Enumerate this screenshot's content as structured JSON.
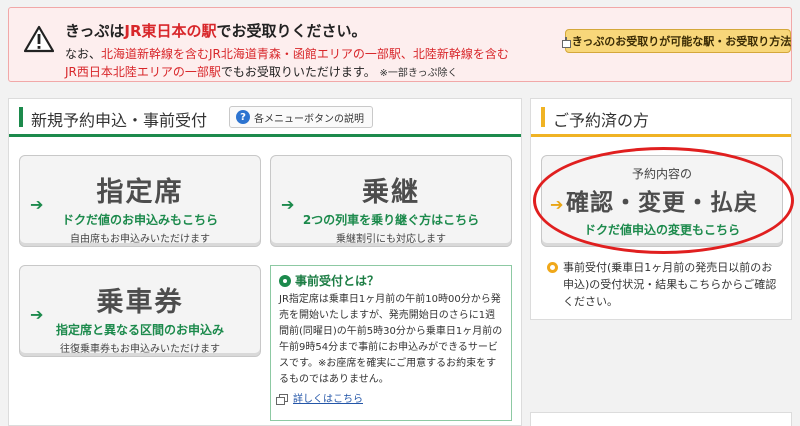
{
  "notice": {
    "line1_pre": "きっぷは",
    "line1_red": "JR東日本の駅",
    "line1_post": "でお受取りください。",
    "line2_pre": "なお、",
    "line2_red": "北海道新幹線を含むJR北海道青森・函館エリアの一部駅、北陸新幹線を含む",
    "line3_red": "JR西日本北陸エリアの一部駅",
    "line3_post": "でもお受取りいただけます。",
    "line3_small": "※一部きっぷ除く",
    "button_label": "きっぷのお受取りが可能な駅・お受取り方法"
  },
  "new_reservation": {
    "title": "新規予約申込・事前受付",
    "help_label": "各メニューボタンの説明",
    "seat": {
      "big": "指定席",
      "brand": "ドクだ値",
      "sub": "のお申込みもこちら",
      "note": "自由席もお申込みいただけます"
    },
    "transfer": {
      "big": "乗継",
      "sub": "2つの列車を乗り継ぐ方はこちら",
      "note": "乗継割引にも対応します"
    },
    "ticket": {
      "big": "乗車券",
      "sub": "指定席と異なる区間のお申込み",
      "note": "往復乗車券もお申込みいただけます"
    },
    "advance": {
      "heading": "事前受付とは？",
      "body": "JR指定席は乗車日1ヶ月前の午前10時00分から発売を開始いたしますが、発売開始日のさらに1週間前(同曜日)の午前5時30分から乗車日1ヶ月前の午前9時54分まで事前にお申込みができるサービスです。※お座席を確実にご用意するお約束をするものではありません。",
      "link": "詳しくはこちら"
    }
  },
  "existing": {
    "title": "ご予約済の方",
    "confirm_top": "予約内容の",
    "confirm_big": "確認・変更・払戻",
    "confirm_brand": "ドクだ値",
    "confirm_sub": "申込の変更もこちら",
    "note": "事前受付(乗車日1ヶ月前の発売日以前のお申込)の受付状況・結果もこちらからご確認ください。"
  },
  "colors": {
    "green": "#1c8a4c",
    "red": "#d8262a",
    "orange": "#f0b324",
    "circle": "#e01f1f"
  }
}
